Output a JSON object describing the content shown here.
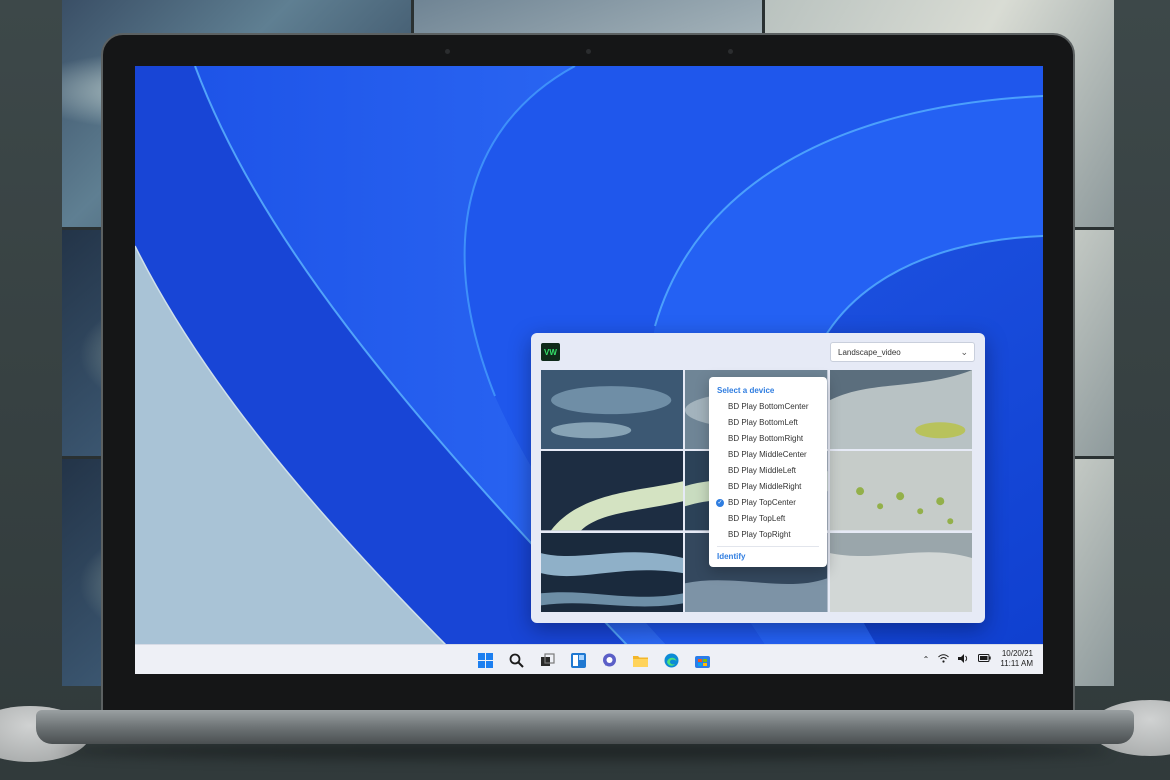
{
  "app": {
    "logo_text": "VW",
    "content_select_value": "Landscape_video"
  },
  "device_menu": {
    "title": "Select a device",
    "items": [
      {
        "label": "BD Play BottomCenter",
        "selected": false
      },
      {
        "label": "BD Play BottomLeft",
        "selected": false
      },
      {
        "label": "BD Play BottomRight",
        "selected": false
      },
      {
        "label": "BD Play MiddleCenter",
        "selected": false
      },
      {
        "label": "BD Play MiddleLeft",
        "selected": false
      },
      {
        "label": "BD Play MiddleRight",
        "selected": false
      },
      {
        "label": "BD Play TopCenter",
        "selected": true
      },
      {
        "label": "BD Play TopLeft",
        "selected": false
      },
      {
        "label": "BD Play TopRight",
        "selected": false
      }
    ],
    "identify_label": "Identify"
  },
  "taskbar": {
    "icons": [
      "windows-start-icon",
      "search-icon",
      "task-view-icon",
      "widgets-icon",
      "chat-icon",
      "file-explorer-icon",
      "edge-browser-icon",
      "store-icon"
    ],
    "clock_date": "10/20/21",
    "clock_time": "11:11 AM"
  },
  "colors": {
    "accent": "#2f7de0",
    "wallpaper_blue": "#1a4fe0",
    "taskbar": "#eef0f6"
  }
}
